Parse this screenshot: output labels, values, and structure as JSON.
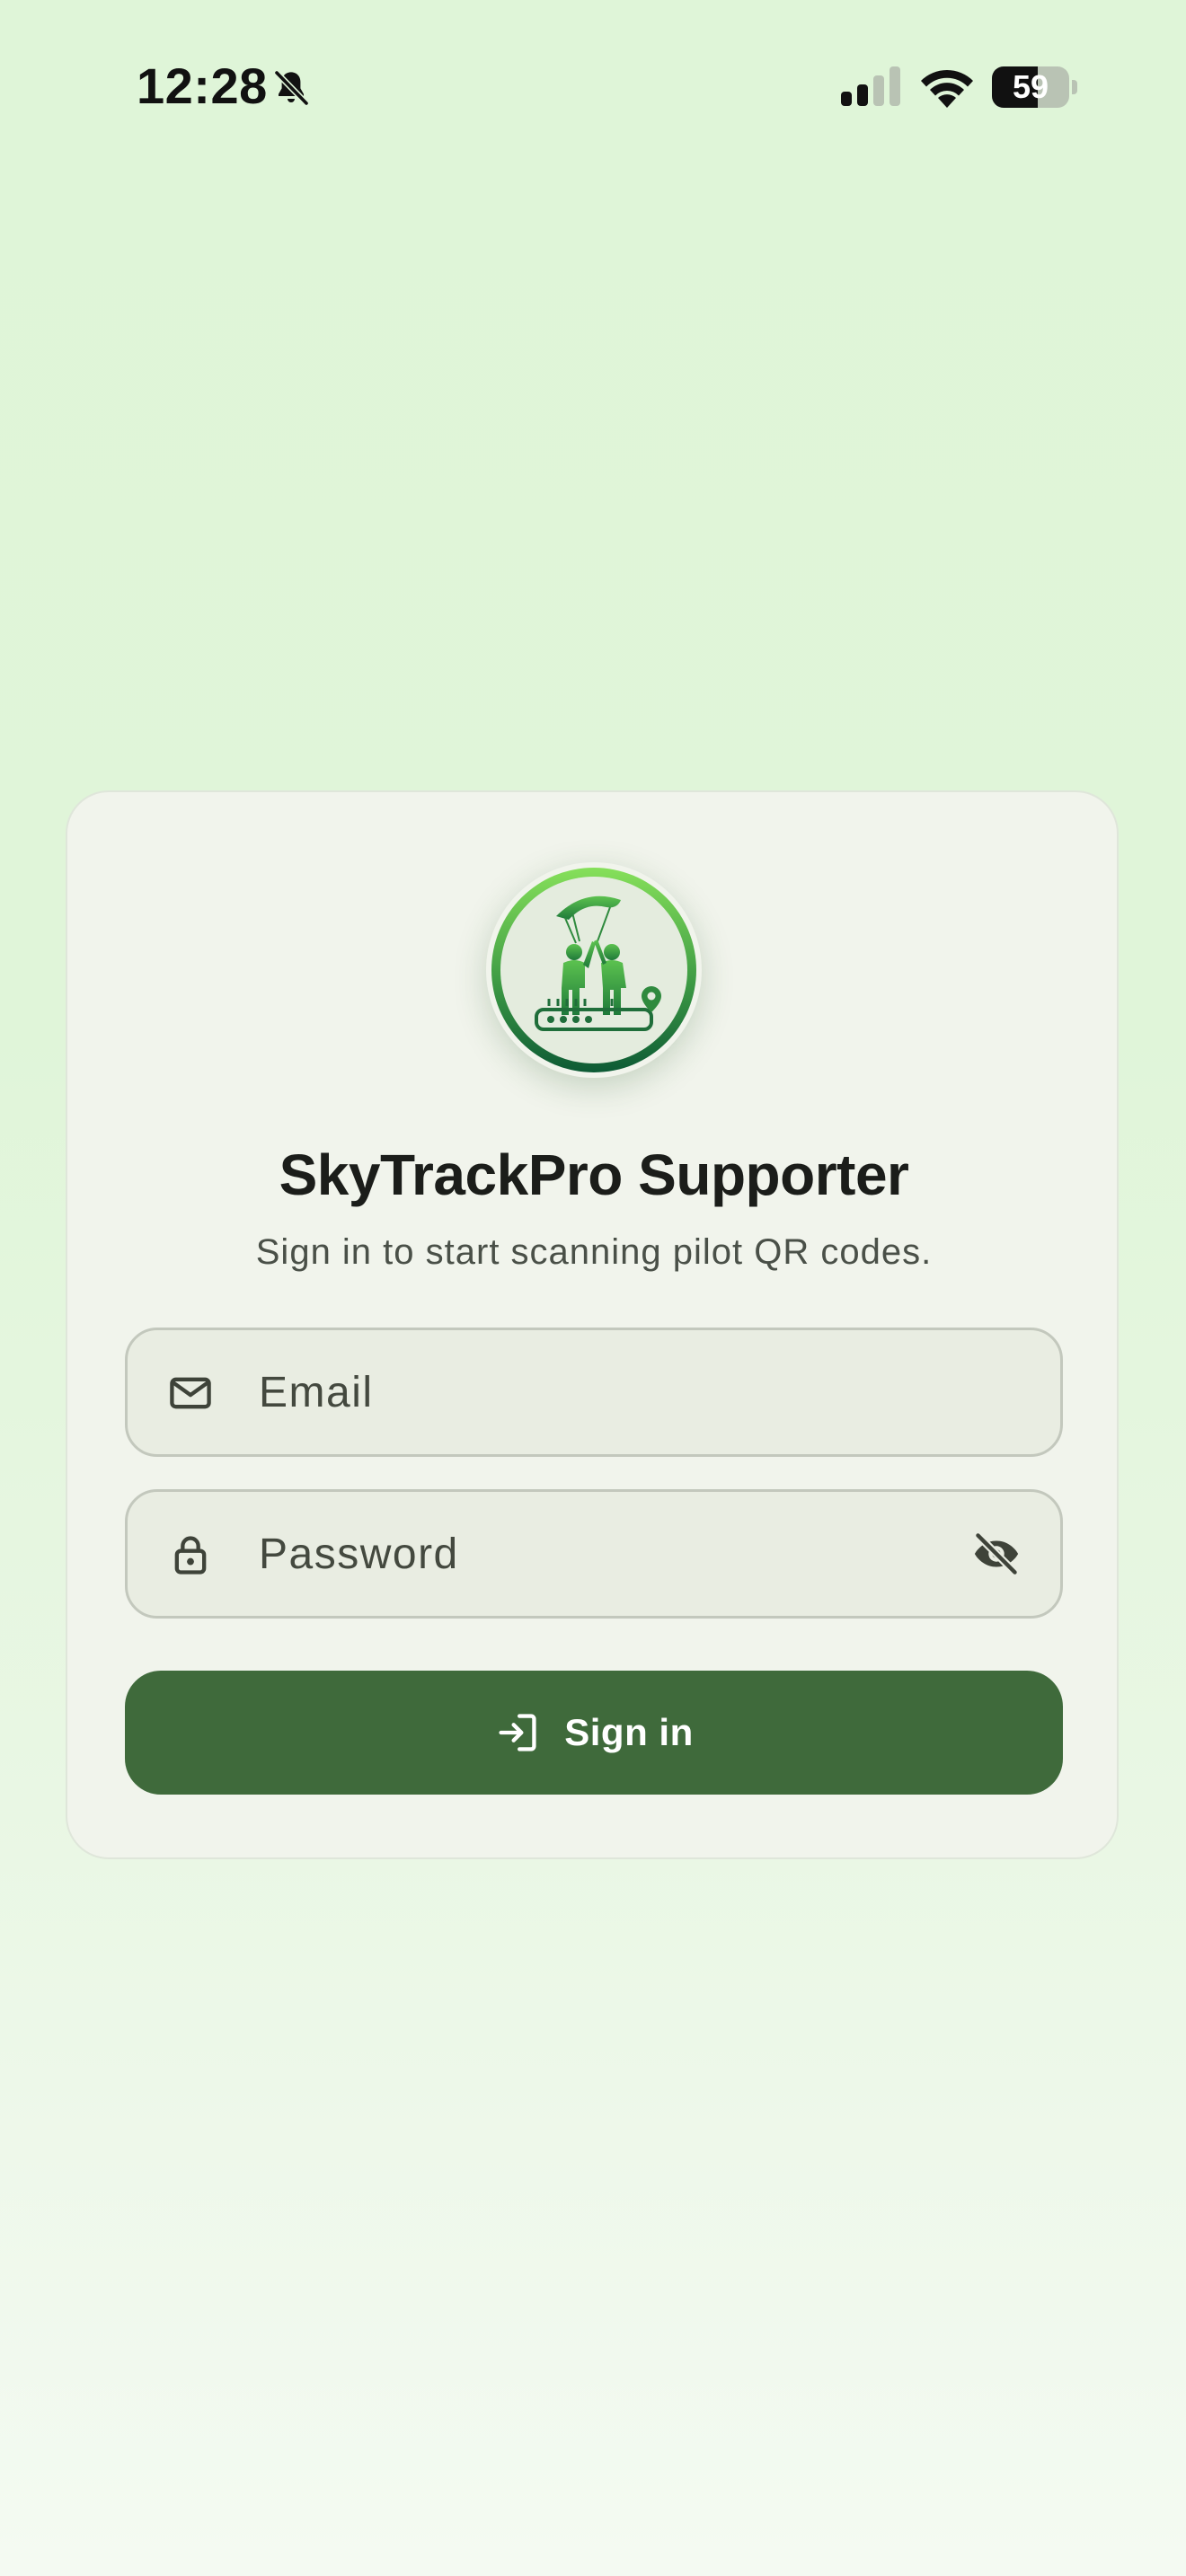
{
  "status_bar": {
    "time": "12:28",
    "battery_percent": 59,
    "battery_label": "59",
    "icons": [
      "bell-slash-icon",
      "cellular-signal-icon",
      "wifi-icon",
      "battery-icon"
    ],
    "signal_bars_active": 2,
    "signal_bars_total": 4
  },
  "login": {
    "logo_icon": "skytrackpro-logo-icon",
    "title": "SkyTrackPro Supporter",
    "subtitle": "Sign in to start scanning pilot QR codes.",
    "email": {
      "icon": "mail-icon",
      "placeholder": "Email",
      "value": ""
    },
    "password": {
      "icon": "lock-icon",
      "placeholder": "Password",
      "value": "",
      "toggle_icon": "visibility-off-icon"
    },
    "submit": {
      "icon": "login-icon",
      "label": "Sign in"
    }
  },
  "colors": {
    "background": "#dff5d8",
    "card": "#f1f4ec",
    "field": "#e9ede2",
    "primary_button": "#3f6a3b",
    "logo_ring_top": "#86e05a",
    "logo_ring_bottom": "#0d5a35"
  }
}
